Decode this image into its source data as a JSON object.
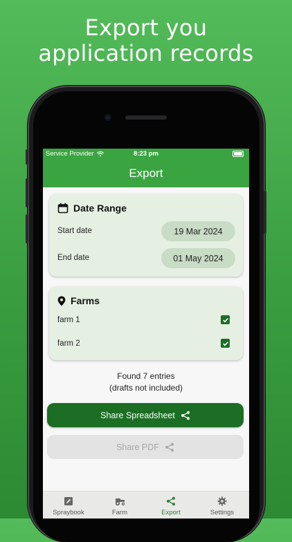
{
  "headline": {
    "line1": "Export you",
    "line2": "application records"
  },
  "status_bar": {
    "carrier": "Service Provider",
    "time": "8:23 pm"
  },
  "app_bar": {
    "title": "Export"
  },
  "date_range": {
    "title": "Date Range",
    "start_label": "Start date",
    "start_value": "19 Mar 2024",
    "end_label": "End date",
    "end_value": "01 May 2024"
  },
  "farms": {
    "title": "Farms",
    "items": [
      {
        "label": "farm 1",
        "checked": true
      },
      {
        "label": "farm 2",
        "checked": true
      }
    ]
  },
  "summary": {
    "found": "Found 7 entries",
    "note": "(drafts not included)"
  },
  "actions": {
    "share_spreadsheet": "Share Spreadsheet",
    "share_pdf": "Share PDF"
  },
  "tabs": [
    {
      "label": "Spraybook",
      "icon": "edit-note-icon",
      "active": false
    },
    {
      "label": "Farm",
      "icon": "tractor-icon",
      "active": false
    },
    {
      "label": "Export",
      "icon": "share-icon",
      "active": true
    },
    {
      "label": "Settings",
      "icon": "gear-icon",
      "active": false
    }
  ],
  "colors": {
    "primary": "#1b6e24",
    "appbar": "#3aa441",
    "card": "#e6f0e2",
    "active_tab": "#2e7d32"
  }
}
